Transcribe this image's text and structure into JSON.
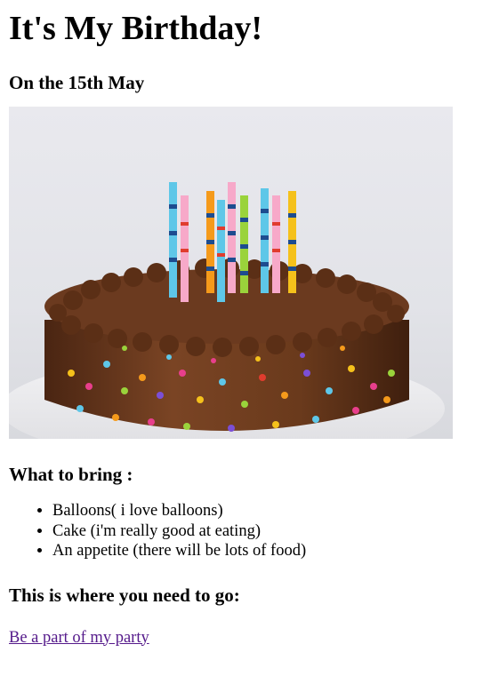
{
  "page": {
    "title": "It's My Birthday!",
    "date_heading": "On the 15th May",
    "bring_heading": "What to bring :",
    "bring_items": [
      "Balloons( i love balloons)",
      "Cake (i'm really good at eating)",
      "An appetite (there will be lots of food)"
    ],
    "go_heading": "This is where you need to go:",
    "party_link": "Be a part of my party"
  },
  "colors": {
    "link_visited": "#551a8b",
    "cake_frosting": "#6b3a1f",
    "background": "#ffffff"
  }
}
